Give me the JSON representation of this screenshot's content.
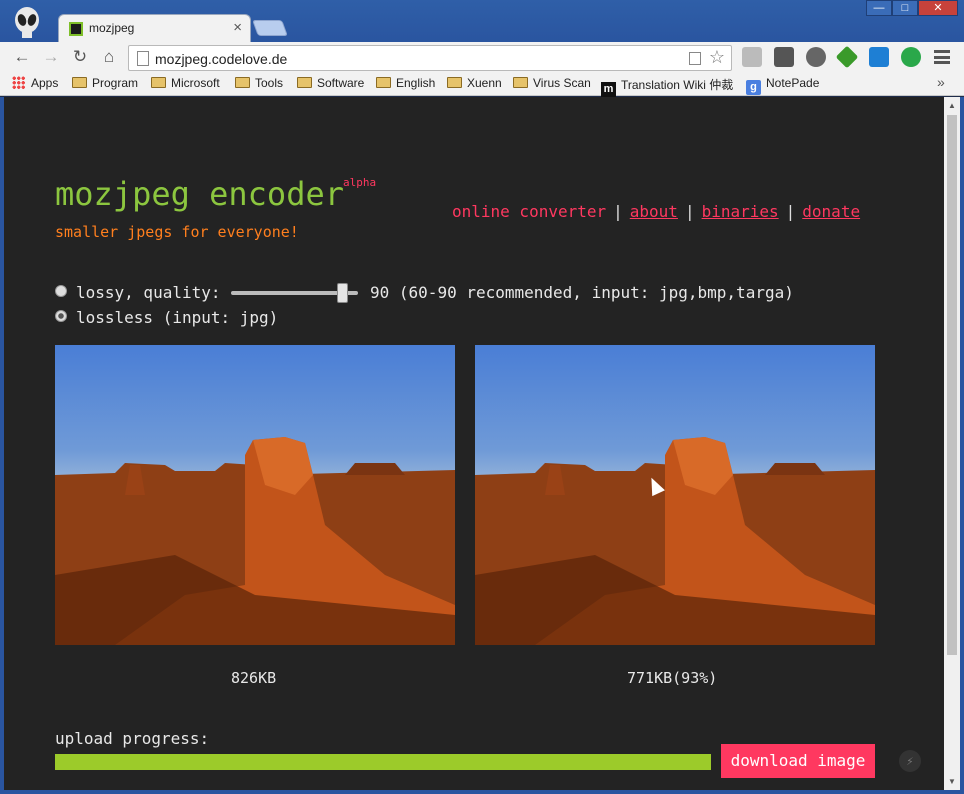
{
  "browser": {
    "tab_title": "mozjpeg",
    "tab_close": "×",
    "url": "mozjpeg.codelove.de",
    "window_buttons": {
      "minimize": "—",
      "maximize": "□",
      "close": "✕"
    },
    "nav": {
      "back": "←",
      "forward": "→",
      "reload": "↻",
      "home": "⌂",
      "star": "☆"
    }
  },
  "bookmarks": [
    {
      "label": "Apps",
      "icon": "apps-grid-icon"
    },
    {
      "label": "Program",
      "icon": "folder-icon"
    },
    {
      "label": "Microsoft",
      "icon": "folder-icon"
    },
    {
      "label": "Tools",
      "icon": "folder-icon"
    },
    {
      "label": "Software",
      "icon": "folder-icon"
    },
    {
      "label": "English",
      "icon": "folder-icon"
    },
    {
      "label": "Xuenn",
      "icon": "folder-icon"
    },
    {
      "label": "Virus Scan",
      "icon": "folder-icon"
    },
    {
      "label": "Translation Wiki 仲裁",
      "icon": "m-icon"
    },
    {
      "label": "NotePade",
      "icon": "google-icon"
    }
  ],
  "bookmarks_more": "»",
  "site": {
    "title": "mozjpeg encoder",
    "badge": "alpha",
    "tagline": "smaller jpegs for everyone!",
    "nav": {
      "converter": "online converter",
      "about": "about",
      "binaries": "binaries",
      "donate": "donate",
      "separator": "|"
    }
  },
  "options": {
    "lossy_label": "lossy, quality:",
    "quality_value": "90",
    "quality_hint": "(60-90 recommended, input: jpg,bmp,targa)",
    "lossless_label": "lossless (input: jpg)",
    "selected": "lossless"
  },
  "images": {
    "original_size": "826KB",
    "compressed_size": "771KB(93%)"
  },
  "progress": {
    "label": "upload progress:",
    "value_percent": 100
  },
  "download_label": "download image",
  "colors": {
    "title": "#8cc63f",
    "accent": "#ff3860",
    "tagline": "#ff7f1e",
    "progress": "#9ccb2a",
    "background": "#232323"
  }
}
